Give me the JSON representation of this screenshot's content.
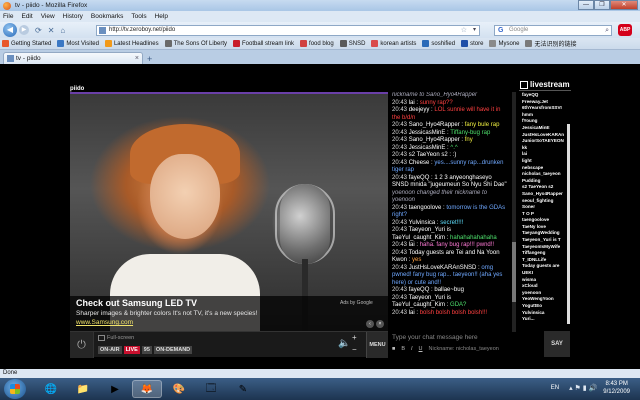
{
  "window": {
    "title": "tv - piido - Mozilla Firefox",
    "minimize": "—",
    "maximize": "❐",
    "close": "✕"
  },
  "menu": [
    "File",
    "Edit",
    "View",
    "History",
    "Bookmarks",
    "Tools",
    "Help"
  ],
  "nav": {
    "url": "http://tv.zeroboy.net/piido",
    "search_placeholder": "Google",
    "adblock": "ABP"
  },
  "bookmarks": [
    {
      "label": "Getting Started",
      "color": "#e8562a"
    },
    {
      "label": "Most Visited",
      "color": "#3b78c4"
    },
    {
      "label": "Latest Headlines",
      "color": "#f29a1a"
    },
    {
      "label": "The Sons Of Liberty",
      "color": "#6a6a6a"
    },
    {
      "label": "Football stream link",
      "color": "#c81e2b"
    },
    {
      "label": "food blog",
      "color": "#d04040"
    },
    {
      "label": "SNSD",
      "color": "#5a5a5a"
    },
    {
      "label": "korean artists",
      "color": "#d94b4b"
    },
    {
      "label": "soshified",
      "color": "#2a6ab8"
    },
    {
      "label": "store",
      "color": "#1f4fa8"
    },
    {
      "label": "Mysone",
      "color": "#8a8a8a"
    },
    {
      "label": "无法识别的链接",
      "color": "#7a7a7a"
    }
  ],
  "tab": {
    "label": "tv - piido",
    "close": "×",
    "new_tab": "+"
  },
  "player": {
    "label": "piido",
    "ad": {
      "title": "Check out Samsung LED TV",
      "text": "Sharper images & brighter colors It's not TV, it's a new species!",
      "url": "www.Samsung.com",
      "ads_by": "Ads by Google"
    },
    "fullscreen": "Full-screen",
    "on_air": "ON-AIR",
    "live": "LIVE",
    "viewers": "95",
    "on_demand": "ON-DEMAND",
    "menu": "MENU"
  },
  "chat": {
    "messages": [
      {
        "time": "",
        "user": "",
        "text": "nickname to Sano_Hyo4Rapper",
        "style": "sys"
      },
      {
        "time": "20:43",
        "user": "lai :",
        "text": "sunny rap??",
        "style": "cr"
      },
      {
        "time": "20:43",
        "user": "deejeyy :",
        "text": "LOL sunnie will have it in the b/d/n",
        "style": "cr"
      },
      {
        "time": "20:43",
        "user": "Sano_Hyo4Rapper :",
        "text": "fany bule rap",
        "style": "cy"
      },
      {
        "time": "20:43",
        "user": "JessicasMinE :",
        "text": "Tiffany-bug rap",
        "style": "cg"
      },
      {
        "time": "20:43",
        "user": "Sano_Hyo4Rapper :",
        "text": "fny",
        "style": "cy"
      },
      {
        "time": "20:43",
        "user": "JessicasMinE :",
        "text": "^.^",
        "style": "cg"
      },
      {
        "time": "20:43",
        "user": "s2 TaeYeon s2 :",
        "text": ":)",
        "style": ""
      },
      {
        "time": "20:43",
        "user": "Cheese :",
        "text": "yes....sunny rap...drunken tiger rap",
        "style": "cb"
      },
      {
        "time": "20:43",
        "user": "fayeQQ :",
        "text": "1 2 3 anyeonghaseyo SNSD mnida \"jugeumeun So Nyu Shi Dae\"",
        "style": ""
      },
      {
        "time": "20:43",
        "user": "",
        "text": "yoenoon changed their nickname to yoenoon",
        "style": "sys"
      },
      {
        "time": "20:43",
        "user": "taengoolove :",
        "text": "tomorrow is the GDAs right?",
        "style": "cb"
      },
      {
        "time": "20:43",
        "user": "Yulvinsica :",
        "text": "secret!!!!",
        "style": "cc"
      },
      {
        "time": "20:43",
        "user": "Taeyeon_Yuri is",
        "text": "",
        "style": ""
      },
      {
        "time": "",
        "user": "TaeYul_caught_Kim :",
        "text": "hahahahahahaha",
        "style": "cg"
      },
      {
        "time": "20:43",
        "user": "lai :",
        "text": "haha. fany bug rap!!! pwnd!!",
        "style": "cp"
      },
      {
        "time": "20:43",
        "user": "Today guests are Tei and Na Yoon Kwon :",
        "text": "yes",
        "style": "co"
      },
      {
        "time": "20:43",
        "user": "JustHsLoveKARAnSNSD :",
        "text": "omg pwned! fany bug rap... taeyeon!! (aha yes here) or cute and!!",
        "style": "cb"
      },
      {
        "time": "20:43",
        "user": "fayeQQ :",
        "text": "ballae~bug",
        "style": ""
      },
      {
        "time": "20:43",
        "user": "Taeyeon_Yuri is",
        "text": "",
        "style": ""
      },
      {
        "time": "",
        "user": "TaeYul_caught_Kim :",
        "text": "GDA?",
        "style": "cg"
      },
      {
        "time": "20:43",
        "user": "lai :",
        "text": "bolsh bolsh bolsh bolsh!!!",
        "style": "cr"
      }
    ],
    "input_placeholder": "Type your chat message here",
    "bold": "B",
    "italic": "I",
    "underline": "U",
    "nickname": "Nickname: nicholas_taeyeon",
    "say": "SAY"
  },
  "livestream": {
    "brand": "livestream",
    "users": [
      "fayeQQ",
      "Freeway.Jet",
      "6thYearsfromSSVI",
      "hmm",
      "fYoung",
      "JessicaMinE",
      "JustHsLoveKARAn",
      "JuniorSoTAEYEON",
      "kk",
      "lai",
      "light",
      "nebscape",
      "nicholas_taeyeon",
      "Pudding",
      "s2 TaeYeon s2",
      "Sano_Hyo4Rapper",
      "seoul_fighting",
      "Soner",
      "T O P",
      "taengoolove",
      "TaeNy love",
      "TaeyangWedding",
      "Taeyeon_Yuri is T",
      "TaeyeonIsMyWife",
      "Tiffangeng",
      "T_IDNLLife",
      "Today guests are",
      "UEKI",
      "wisma",
      "xCloud",
      "yoenoon",
      "YeoWengYoon",
      "YoguttEo",
      "Yulvinsica",
      "Yuri..."
    ]
  },
  "status": "Done",
  "taskbar": {
    "lang": "EN",
    "time": "8:43 PM",
    "date": "9/12/2009"
  }
}
